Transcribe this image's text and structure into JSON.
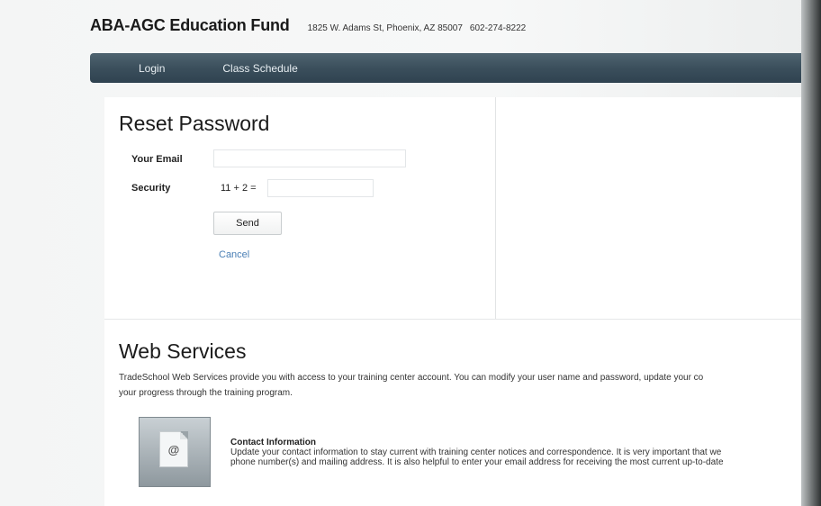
{
  "header": {
    "org_name": "ABA-AGC Education Fund",
    "address": "1825 W. Adams St, Phoenix, AZ 85007",
    "phone": "602-274-8222"
  },
  "nav": {
    "items": [
      {
        "label": "Login"
      },
      {
        "label": "Class Schedule"
      }
    ]
  },
  "reset": {
    "title": "Reset Password",
    "email_label": "Your Email",
    "email_value": "",
    "security_label": "Security",
    "security_question": "11 + 2  =",
    "security_value": "",
    "send_label": "Send",
    "cancel_label": "Cancel"
  },
  "web_services": {
    "title": "Web Services",
    "description_line1": "TradeSchool Web Services provide you with access to your training center account. You can modify your user name and password, update your co",
    "description_line2": "your progress through the training program.",
    "items": [
      {
        "title": "Contact Information",
        "icon": "at-document-icon",
        "line1": "Update your contact information to stay current with training center notices and correspondence. It is very important that we",
        "line2": "phone number(s) and mailing address. It is also helpful to enter your email address for receiving the most current up-to-date"
      }
    ]
  },
  "colors": {
    "nav_bg": "#3b4f5c",
    "link": "#4a7fb5"
  }
}
